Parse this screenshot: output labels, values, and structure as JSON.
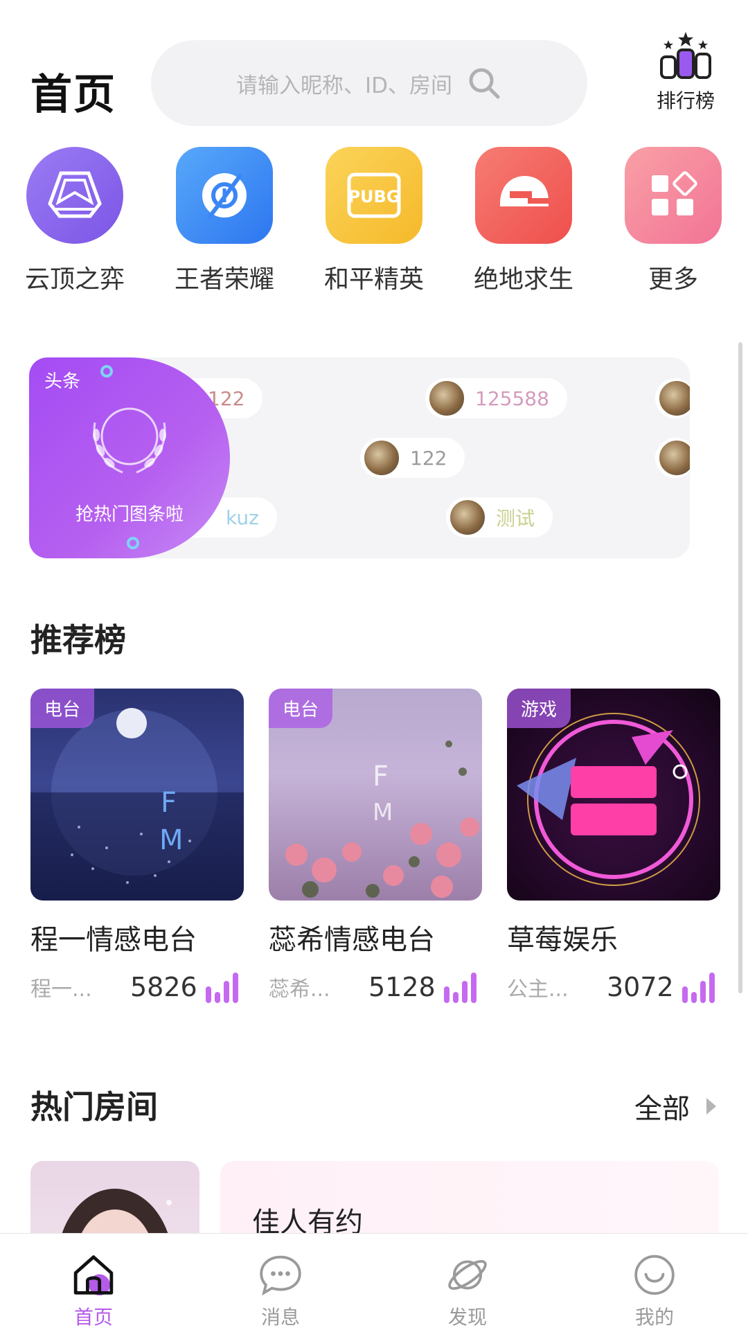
{
  "header": {
    "title": "首页",
    "search_placeholder": "请输入昵称、ID、房间",
    "rank_label": "排行榜"
  },
  "games": [
    {
      "label": "云顶之弈",
      "icon": "tft-icon",
      "color": "#8f6df0"
    },
    {
      "label": "王者荣耀",
      "icon": "honor-of-kings-icon",
      "color": "#3e8df7"
    },
    {
      "label": "和平精英",
      "icon": "pubg-icon",
      "color": "#f8c62a"
    },
    {
      "label": "绝地求生",
      "icon": "helmet-icon",
      "color": "#f4655f"
    },
    {
      "label": "更多",
      "icon": "more-grid-icon",
      "color": "#f58aa3"
    }
  ],
  "headline": {
    "tag": "头条",
    "promo_text": "抢热门图条啦",
    "chips": [
      {
        "text": "122",
        "color": "#c98a8a"
      },
      {
        "text": "125588",
        "color": "#d49bbd"
      },
      {
        "text": "122",
        "color": "#9a9a9a"
      },
      {
        "text": "测试",
        "color": "#c9cf8e"
      },
      {
        "text": "kuz",
        "color": "#9fd0e8"
      }
    ]
  },
  "recommend": {
    "title": "推荐榜",
    "items": [
      {
        "tag": "电台",
        "title": "程一情感电台",
        "owner": "程一...",
        "count": "5826"
      },
      {
        "tag": "电台",
        "title": "蕊希情感电台",
        "owner": "蕊希...",
        "count": "5128"
      },
      {
        "tag": "游戏",
        "title": "草莓娱乐",
        "owner": "公主...",
        "count": "3072"
      }
    ]
  },
  "hot_rooms": {
    "title": "热门房间",
    "more_label": "全部",
    "first_room": "佳人有约"
  },
  "tabbar": {
    "tabs": [
      {
        "label": "首页",
        "active": true
      },
      {
        "label": "消息",
        "active": false
      },
      {
        "label": "发现",
        "active": false
      },
      {
        "label": "我的",
        "active": false
      }
    ]
  },
  "colors": {
    "accent": "#b45bea",
    "promo": "#a44cf4"
  }
}
